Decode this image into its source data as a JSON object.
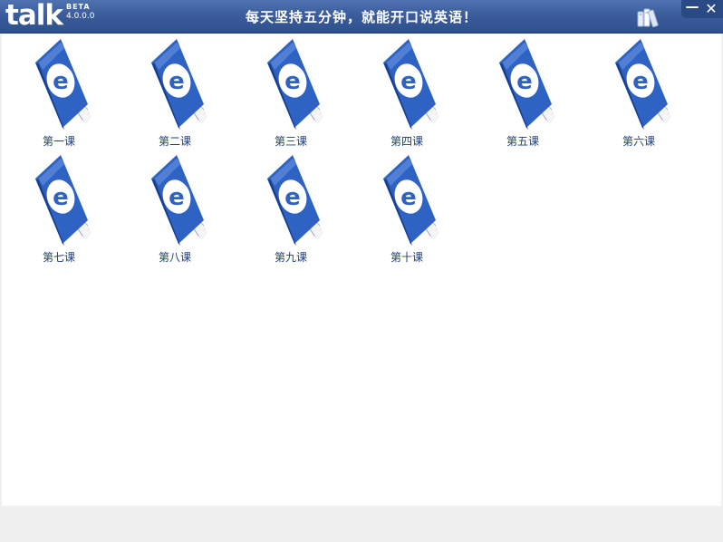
{
  "titlebar": {
    "logo_text": "talk",
    "logo_beta": "BETA",
    "logo_version": "4.0.0.0",
    "slogan": "每天坚持五分钟，就能开口说英语！",
    "books_icon": "books-icon",
    "minimize_glyph": "—",
    "close_glyph": "✕"
  },
  "lessons": [
    {
      "label": "第一课",
      "icon": "ebook-icon"
    },
    {
      "label": "第二课",
      "icon": "ebook-icon"
    },
    {
      "label": "第三课",
      "icon": "ebook-icon"
    },
    {
      "label": "第四课",
      "icon": "ebook-icon"
    },
    {
      "label": "第五课",
      "icon": "ebook-icon"
    },
    {
      "label": "第六课",
      "icon": "ebook-icon"
    },
    {
      "label": "第七课",
      "icon": "ebook-icon"
    },
    {
      "label": "第八课",
      "icon": "ebook-icon"
    },
    {
      "label": "第九课",
      "icon": "ebook-icon"
    },
    {
      "label": "第十课",
      "icon": "ebook-icon"
    }
  ],
  "colors": {
    "titlebar": "#3c5d9c",
    "book_cover": "#2e63c4",
    "label_text": "#1f3f7a"
  }
}
